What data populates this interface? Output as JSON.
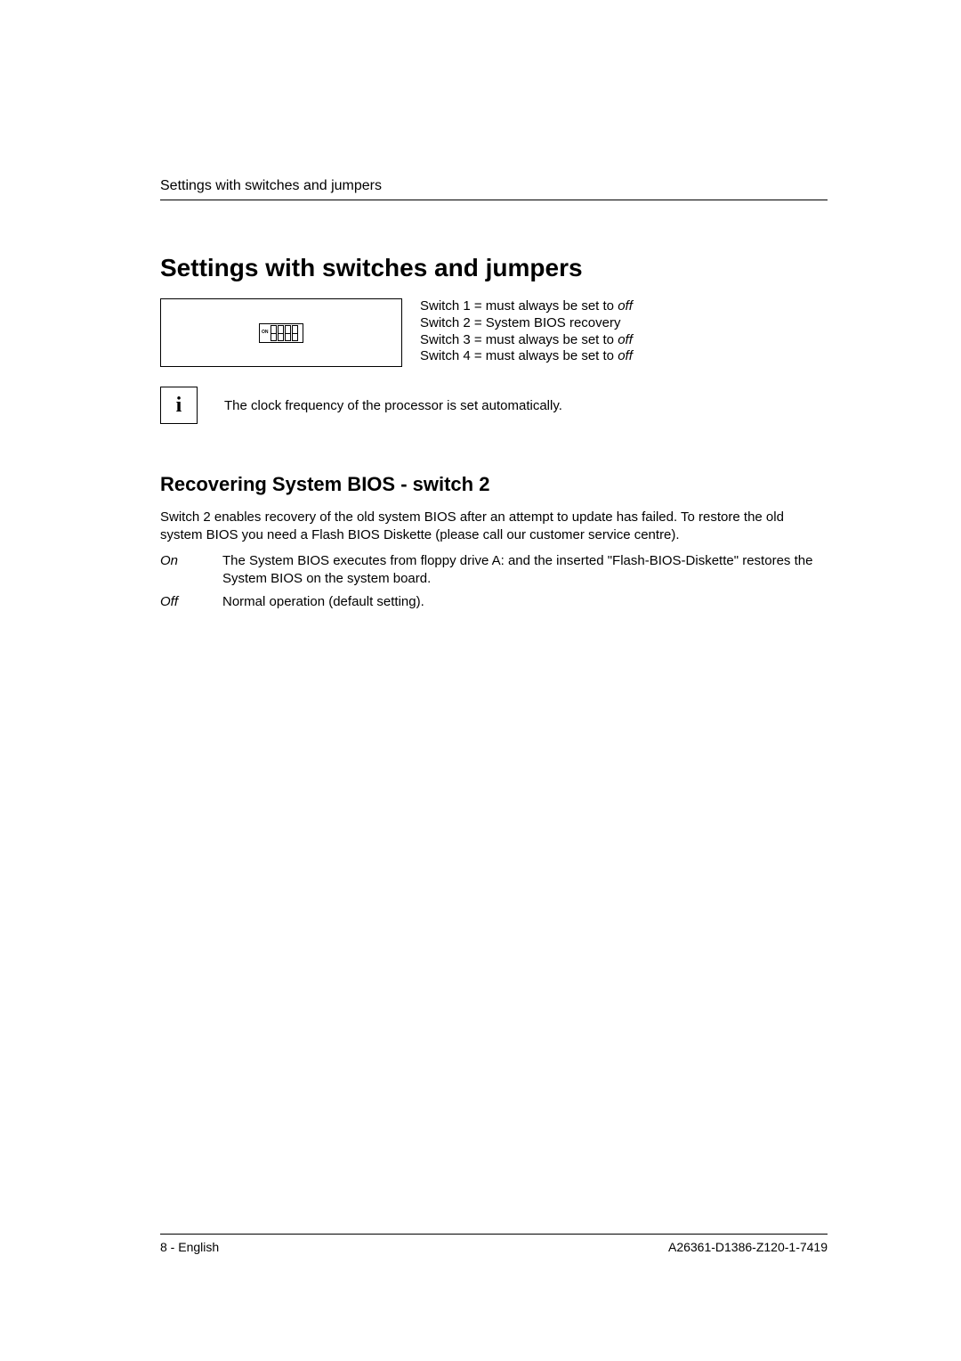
{
  "running_head": "Settings with switches and jumpers",
  "title": "Settings with switches and jumpers",
  "dip": {
    "on_label": "ON"
  },
  "switch_list": [
    {
      "prefix": "Switch 1 = must always be set to ",
      "suffix_italic": "off"
    },
    {
      "prefix": "Switch 2 = System BIOS recovery",
      "suffix_italic": ""
    },
    {
      "prefix": "Switch 3 = must always be set to ",
      "suffix_italic": "off"
    },
    {
      "prefix": "Switch 4 = must always be set to ",
      "suffix_italic": "off"
    }
  ],
  "info_icon": "i",
  "info_text": "The clock frequency of the processor is set automatically.",
  "subtitle": "Recovering System BIOS - switch 2",
  "para1": "Switch 2 enables recovery of the old system BIOS after an attempt to update has failed. To restore the old system BIOS you need a Flash BIOS Diskette (please call our customer service centre).",
  "defs": [
    {
      "term": "On",
      "desc": "The System BIOS executes from floppy drive A: and the inserted \"Flash-BIOS-Diskette\" restores the System BIOS on the system board."
    },
    {
      "term": "Off",
      "desc": "Normal operation (default setting)."
    }
  ],
  "footer_left": "8 - English",
  "footer_right": "A26361-D1386-Z120-1-7419"
}
